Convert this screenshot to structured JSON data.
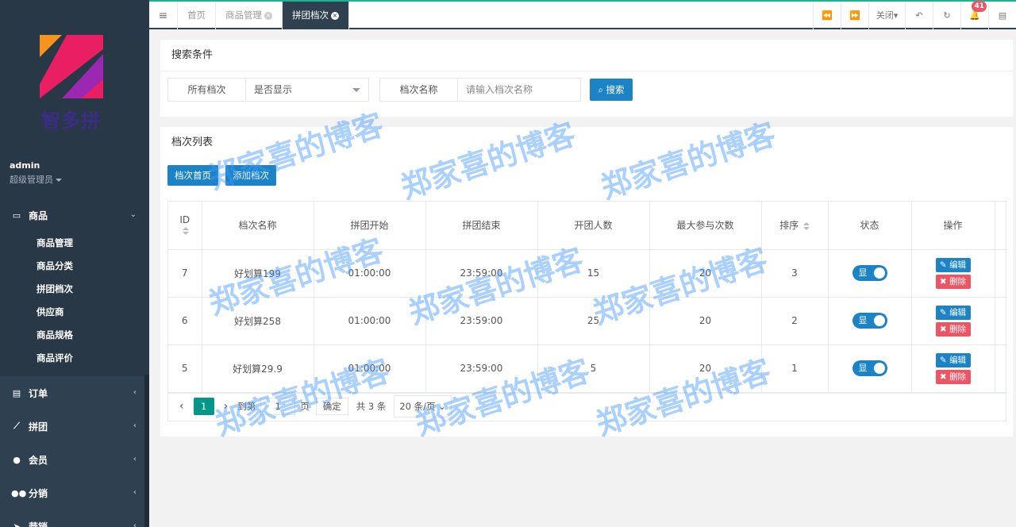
{
  "sidebar": {
    "brand": "智多拼",
    "user": {
      "name": "admin",
      "role": "超级管理员"
    },
    "groups": [
      {
        "label": "商品",
        "icon": "laptop-icon",
        "expanded": true,
        "items": [
          "商品管理",
          "商品分类",
          "拼团档次",
          "供应商",
          "商品规格",
          "商品评价"
        ]
      },
      {
        "label": "订单",
        "icon": "file-icon"
      },
      {
        "label": "拼团",
        "icon": "chart-icon"
      },
      {
        "label": "会员",
        "icon": "user-icon"
      },
      {
        "label": "分销",
        "icon": "users-icon"
      },
      {
        "label": "营销",
        "icon": "send-icon"
      }
    ]
  },
  "topbar": {
    "tabs": [
      {
        "label": "首页"
      },
      {
        "label": "商品管理"
      },
      {
        "label": "拼团档次"
      }
    ],
    "close_label": "关闭",
    "notification_count": "41"
  },
  "search": {
    "title": "搜索条件",
    "level_label": "所有档次",
    "display_select": "是否显示",
    "name_label": "档次名称",
    "name_placeholder": "请输入档次名称",
    "search_button": "搜索"
  },
  "list": {
    "title": "档次列表",
    "btn_home": "档次首页",
    "btn_add": "添加档次",
    "columns": [
      "ID",
      "档次名称",
      "拼团开始",
      "拼团结束",
      "开团人数",
      "最大参与次数",
      "排序",
      "状态",
      "操作"
    ],
    "rows": [
      {
        "id": "7",
        "name": "好划算199",
        "start": "01:00:00",
        "end": "23:59:00",
        "open": "15",
        "max": "20",
        "sort": "3",
        "status": "显"
      },
      {
        "id": "6",
        "name": "好划算258",
        "start": "01:00:00",
        "end": "23:59:00",
        "open": "25",
        "max": "20",
        "sort": "2",
        "status": "显"
      },
      {
        "id": "5",
        "name": "好划算29.9",
        "start": "01:00:00",
        "end": "23:59:00",
        "open": "5",
        "max": "20",
        "sort": "1",
        "status": "显"
      }
    ],
    "edit_label": "编辑",
    "delete_label": "删除"
  },
  "pager": {
    "current": "1",
    "goto_prefix": "到第",
    "goto_value": "1",
    "goto_suffix": "页",
    "confirm": "确定",
    "total": "共 3 条",
    "page_size": "20 条/页"
  },
  "watermark": "郑家喜的博客",
  "colors": {
    "sidebar": "#2f4050",
    "primary": "#1c84c6",
    "danger": "#ed5565",
    "pager_active": "#009688"
  }
}
